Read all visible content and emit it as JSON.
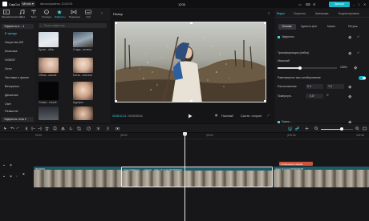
{
  "app": {
    "name": "CapCut",
    "menu_label": "Меню",
    "autosave": "Автосохранено: 10:42:00",
    "project_name": "1205",
    "export_label": "Экспорт"
  },
  "toolbar": {
    "items": [
      {
        "label": "Медиаматериалы",
        "icon": "media-icon"
      },
      {
        "label": "Звук",
        "icon": "audio-icon"
      },
      {
        "label": "Текст",
        "icon": "text-icon"
      },
      {
        "label": "Стикеры",
        "icon": "sticker-icon"
      },
      {
        "label": "Эффекты",
        "icon": "effects-icon"
      },
      {
        "label": "Переходы",
        "icon": "transitions-icon"
      },
      {
        "label": "Суб",
        "icon": "captions-icon"
      }
    ]
  },
  "sidelist": {
    "header": "Эффекты в...",
    "items": [
      "В тренде",
      "Искусство ИИ",
      "Классика",
      "НОВОЕ",
      "Хиты",
      "Заставки и финал",
      "Вечеринки",
      "Движение",
      "Свет",
      "Размытие"
    ],
    "footer": "Эффекты тела"
  },
  "effects": {
    "search_placeholder": "Поиск эффектов",
    "tiles": [
      {
        "label": "Кулон...обок"
      },
      {
        "label": "Стадо...пелена"
      },
      {
        "label": "Облак...ажный"
      },
      {
        "label": "Блеск...оническ"
      },
      {
        "label": "Отсвет...ечный"
      },
      {
        "label": "Кругфон"
      }
    ]
  },
  "player": {
    "title": "Плеер",
    "timecode_current": "00:00:01:21",
    "timecode_total": "00:00:05:04",
    "buttons": [
      "Полный",
      "Соотн. сторон"
    ]
  },
  "right": {
    "tabs": [
      "Видео",
      "Скорость",
      "Анимация",
      "Корректировать"
    ],
    "subtabs": [
      "Основн.",
      "Удалить фон",
      "Маска",
      "Ретушь"
    ],
    "effects_label": "Эффекты",
    "transform_label": "Трансформация (нейяз)",
    "scale_label": "Масштаб",
    "scale_value": "100%",
    "uniform_label": "Равномерное мас.штабирование",
    "position_label": "Расположение",
    "pos_x": "X 0",
    "pos_y": "Y 0",
    "rotate_label": "Повернуть",
    "rotate_value": "0,0°",
    "blend_label": "Смеш..."
  },
  "timeline": {
    "ruler": [
      "00:00",
      "|00:02",
      "|00:04",
      "|100:06",
      "100:08"
    ],
    "clip_effect_label": "Отсвечение сиянии",
    "clip_main_label": "Спецэффекты · ...сияние · video (1).mp4  00:00:05:04",
    "clip_left_label": "00:00:00",
    "clip_right_label": "video (1).mp4  00:00:05:05"
  }
}
